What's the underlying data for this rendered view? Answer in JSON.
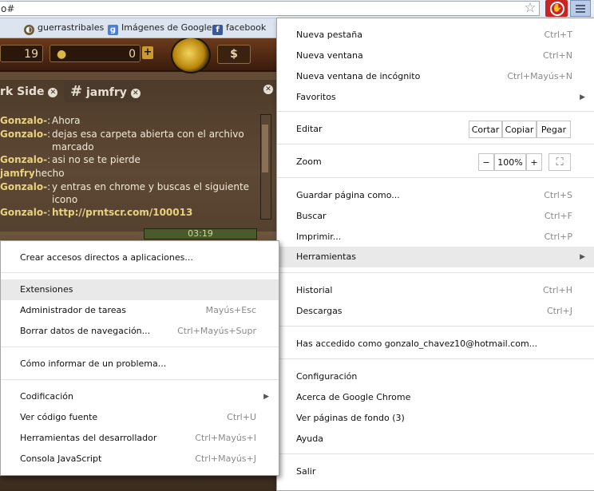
{
  "omnibox": {
    "url": "o#"
  },
  "icons": {
    "star": "star-icon",
    "extension": "stop-extension-icon",
    "menu": "chrome-menu-icon"
  },
  "bookmarks": [
    {
      "label": "guerrastribales",
      "icon": "guerrastribales-favicon"
    },
    {
      "label": "Imágenes de Google",
      "icon": "google-g-icon"
    },
    {
      "label": "facebook",
      "icon": "facebook-f-icon"
    }
  ],
  "game": {
    "resource_left": "19",
    "resource_gold": "0",
    "plus": "+",
    "dollar": "$",
    "tab_left": "rk Side",
    "tab_active": "jamfry",
    "hash": "#",
    "chat": [
      {
        "user": "Gonzalo-",
        "sep": ":",
        "msg": "Ahora"
      },
      {
        "user": "Gonzalo-",
        "sep": ":",
        "msg": "dejas esa carpeta abierta con el archivo marcado"
      },
      {
        "user": "Gonzalo-",
        "sep": ":",
        "msg": "asi no se te pierde"
      },
      {
        "user": "jamfry",
        "sep": ":",
        "msg": "hecho"
      },
      {
        "user": "Gonzalo-",
        "sep": ":",
        "msg": "y entras en chrome y buscas el siguiente icono"
      },
      {
        "user": "Gonzalo-",
        "sep": ":",
        "msg": "http://prntscr.com/100013"
      }
    ],
    "timer": "03:19"
  },
  "main_menu": {
    "new_tab": {
      "label": "Nueva pestaña",
      "shortcut": "Ctrl+T"
    },
    "new_window": {
      "label": "Nueva ventana",
      "shortcut": "Ctrl+N"
    },
    "incognito": {
      "label": "Nueva ventana de incógnito",
      "shortcut": "Ctrl+Mayús+N"
    },
    "favorites": {
      "label": "Favoritos"
    },
    "edit": {
      "label": "Editar",
      "cut": "Cortar",
      "copy": "Copiar",
      "paste": "Pegar"
    },
    "zoom": {
      "label": "Zoom",
      "minus": "−",
      "value": "100%",
      "plus": "+"
    },
    "save_page": {
      "label": "Guardar página como...",
      "shortcut": "Ctrl+S"
    },
    "find": {
      "label": "Buscar",
      "shortcut": "Ctrl+F"
    },
    "print": {
      "label": "Imprimir...",
      "shortcut": "Ctrl+P"
    },
    "tools": {
      "label": "Herramientas"
    },
    "history": {
      "label": "Historial",
      "shortcut": "Ctrl+H"
    },
    "downloads": {
      "label": "Descargas",
      "shortcut": "Ctrl+J"
    },
    "signed_in": {
      "label": "Has accedido como gonzalo_chavez10@hotmail.com..."
    },
    "settings": {
      "label": "Configuración"
    },
    "about": {
      "label": "Acerca de Google Chrome"
    },
    "background_pages": {
      "label": "Ver páginas de fondo (3)"
    },
    "help": {
      "label": "Ayuda"
    },
    "exit": {
      "label": "Salir"
    }
  },
  "tools_menu": {
    "create_shortcuts": {
      "label": "Crear accesos directos a aplicaciones..."
    },
    "extensions": {
      "label": "Extensiones"
    },
    "task_manager": {
      "label": "Administrador de tareas",
      "shortcut": "Mayús+Esc"
    },
    "clear_data": {
      "label": "Borrar datos de navegación...",
      "shortcut": "Ctrl+Mayús+Supr"
    },
    "report_issue": {
      "label": "Cómo informar de un problema..."
    },
    "encoding": {
      "label": "Codificación"
    },
    "view_source": {
      "label": "Ver código fuente",
      "shortcut": "Ctrl+U"
    },
    "dev_tools": {
      "label": "Herramientas del desarrollador",
      "shortcut": "Ctrl+Mayús+I"
    },
    "js_console": {
      "label": "Consola JavaScript",
      "shortcut": "Ctrl+Mayús+J"
    }
  }
}
